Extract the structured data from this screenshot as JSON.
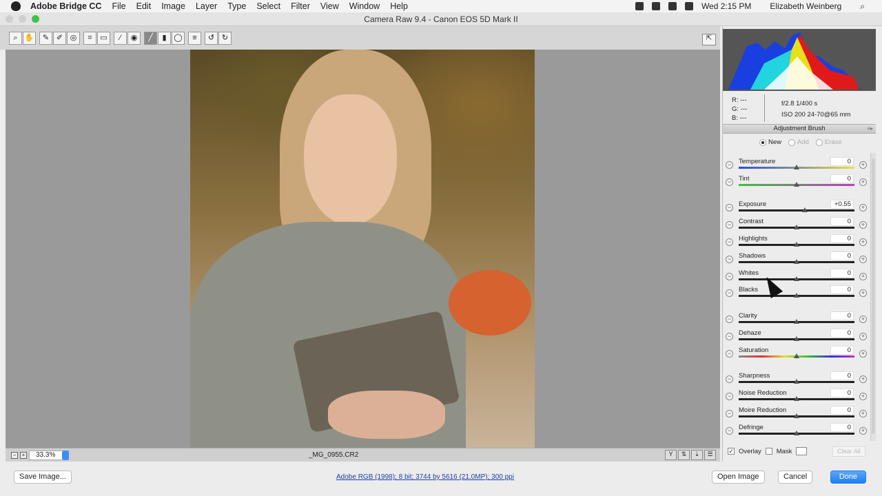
{
  "menubar": {
    "app": "Adobe Bridge CC",
    "items": [
      "File",
      "Edit",
      "Image",
      "Layer",
      "Type",
      "Select",
      "Filter",
      "View",
      "Window",
      "Help"
    ],
    "clock": "Wed 2:15 PM",
    "user": "Elizabeth Weinberg"
  },
  "window": {
    "title": "Camera Raw 9.4  -  Canon EOS 5D Mark II"
  },
  "toolbar": {
    "tools": [
      {
        "name": "zoom-tool",
        "glyph": "⌕"
      },
      {
        "name": "hand-tool",
        "glyph": "✋"
      },
      {
        "name": "white-balance-tool",
        "glyph": "✎"
      },
      {
        "name": "color-sampler-tool",
        "glyph": "✐"
      },
      {
        "name": "targeted-adjustment-tool",
        "glyph": "◎"
      },
      {
        "name": "crop-tool",
        "glyph": "⌗"
      },
      {
        "name": "straighten-tool",
        "glyph": "▭"
      },
      {
        "name": "spot-removal-tool",
        "glyph": "⁄"
      },
      {
        "name": "red-eye-tool",
        "glyph": "◉"
      },
      {
        "name": "adjustment-brush-tool",
        "glyph": "╱",
        "selected": true
      },
      {
        "name": "graduated-filter-tool",
        "glyph": "▮"
      },
      {
        "name": "radial-filter-tool",
        "glyph": "◯"
      },
      {
        "name": "preferences-tool",
        "glyph": "≡"
      },
      {
        "name": "rotate-left-tool",
        "glyph": "↺"
      },
      {
        "name": "rotate-right-tool",
        "glyph": "↻"
      }
    ]
  },
  "status": {
    "zoom": "33.3%",
    "filename": "_MG_0955.CR2"
  },
  "info": {
    "r": "R:  ---",
    "g": "G:  ---",
    "b": "B:  ---",
    "exposure": "f/2.8   1/400 s",
    "iso": "ISO 200   24-70@65 mm"
  },
  "panel": {
    "title": "Adjustment Brush",
    "modes": [
      "New",
      "Add",
      "Erase"
    ],
    "selected_mode": "New",
    "sliders": [
      {
        "label": "Temperature",
        "value": "0",
        "pos": 0,
        "track": "temp"
      },
      {
        "label": "Tint",
        "value": "0",
        "pos": 0,
        "track": "tint"
      },
      {
        "label": "Exposure",
        "value": "+0.55",
        "pos": 0.55,
        "range": 4
      },
      {
        "label": "Contrast",
        "value": "0",
        "pos": 0
      },
      {
        "label": "Highlights",
        "value": "0",
        "pos": 0
      },
      {
        "label": "Shadows",
        "value": "0",
        "pos": 0
      },
      {
        "label": "Whites",
        "value": "0",
        "pos": 0
      },
      {
        "label": "Blacks",
        "value": "0",
        "pos": 0
      },
      {
        "label": "Clarity",
        "value": "0",
        "pos": 0
      },
      {
        "label": "Dehaze",
        "value": "0",
        "pos": 0
      },
      {
        "label": "Saturation",
        "value": "0",
        "pos": 0,
        "track": "sat"
      },
      {
        "label": "Sharpness",
        "value": "0",
        "pos": 0
      },
      {
        "label": "Noise Reduction",
        "value": "0",
        "pos": 0
      },
      {
        "label": "Moire Reduction",
        "value": "0",
        "pos": 0
      },
      {
        "label": "Defringe",
        "value": "0",
        "pos": 0
      }
    ],
    "overlay": "Overlay",
    "overlay_checked": true,
    "mask": "Mask",
    "mask_checked": false,
    "clear_all": "Clear All"
  },
  "footer": {
    "save": "Save Image...",
    "workflow": "Adobe RGB (1998); 8 bit; 3744 by 5616 (21.0MP); 300 ppi",
    "open": "Open Image",
    "cancel": "Cancel",
    "done": "Done"
  },
  "colors": {
    "accent": "#1c7ff0"
  }
}
